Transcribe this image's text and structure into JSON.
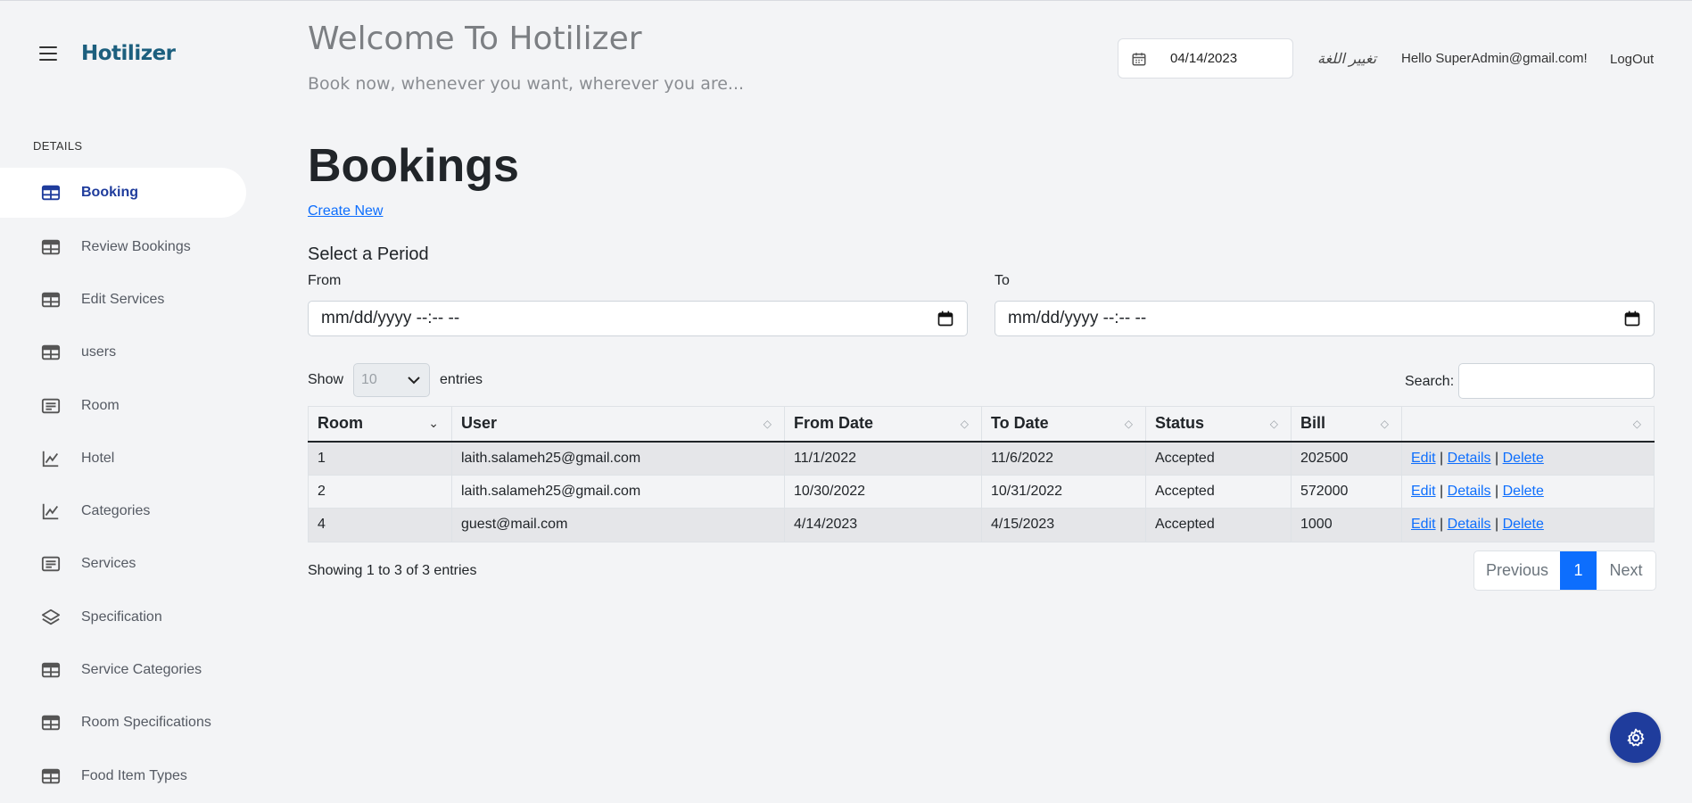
{
  "header": {
    "welcome": "Welcome To Hotilizer",
    "tagline": "Book now, whenever you want, wherever you are...",
    "date": "04/14/2023",
    "language": "تغيير اللغة",
    "hello": "Hello SuperAdmin@gmail.com!",
    "logout": "LogOut"
  },
  "sidebar": {
    "logo": "Hotilizer",
    "section": "DETAILS",
    "items": [
      {
        "label": "Booking",
        "icon": "table-icon"
      },
      {
        "label": "Review Bookings",
        "icon": "table-icon"
      },
      {
        "label": "Edit Services",
        "icon": "table-icon"
      },
      {
        "label": "users",
        "icon": "table-icon"
      },
      {
        "label": "Room",
        "icon": "card-text-icon"
      },
      {
        "label": "Hotel",
        "icon": "chart-line-icon"
      },
      {
        "label": "Categories",
        "icon": "chart-line-icon"
      },
      {
        "label": "Services",
        "icon": "card-text-icon"
      },
      {
        "label": "Specification",
        "icon": "layers-icon"
      },
      {
        "label": "Service Categories",
        "icon": "table-icon"
      },
      {
        "label": "Room Specifications",
        "icon": "table-icon"
      },
      {
        "label": "Food Item Types",
        "icon": "table-icon"
      }
    ]
  },
  "main": {
    "title": "Bookings",
    "create_new": "Create New",
    "period_title": "Select a Period",
    "from_label": "From",
    "to_label": "To",
    "from_value": "mm/dd/yyyy --:-- --",
    "to_value": "mm/dd/yyyy --:-- --",
    "show_label": "Show",
    "entries_value": "10",
    "entries_label": "entries",
    "search_label": "Search:",
    "columns": [
      "Room",
      "User",
      "From Date",
      "To Date",
      "Status",
      "Bill",
      ""
    ],
    "rows": [
      {
        "room": "1",
        "user": "laith.salameh25@gmail.com",
        "from": "11/1/2022",
        "to": "11/6/2022",
        "status": "Accepted",
        "bill": "202500"
      },
      {
        "room": "2",
        "user": "laith.salameh25@gmail.com",
        "from": "10/30/2022",
        "to": "10/31/2022",
        "status": "Accepted",
        "bill": "572000"
      },
      {
        "room": "4",
        "user": "guest@mail.com",
        "from": "4/14/2023",
        "to": "4/15/2023",
        "status": "Accepted",
        "bill": "1000"
      }
    ],
    "actions": {
      "edit": "Edit",
      "sep": "|",
      "details": "Details",
      "delete": "Delete"
    },
    "showing": "Showing 1 to 3 of 3 entries",
    "pager": {
      "previous": "Previous",
      "page": "1",
      "next": "Next"
    }
  },
  "colors": {
    "accent": "#1f3c9c",
    "link": "#0d6efd",
    "logo": "#1c5f7e"
  }
}
